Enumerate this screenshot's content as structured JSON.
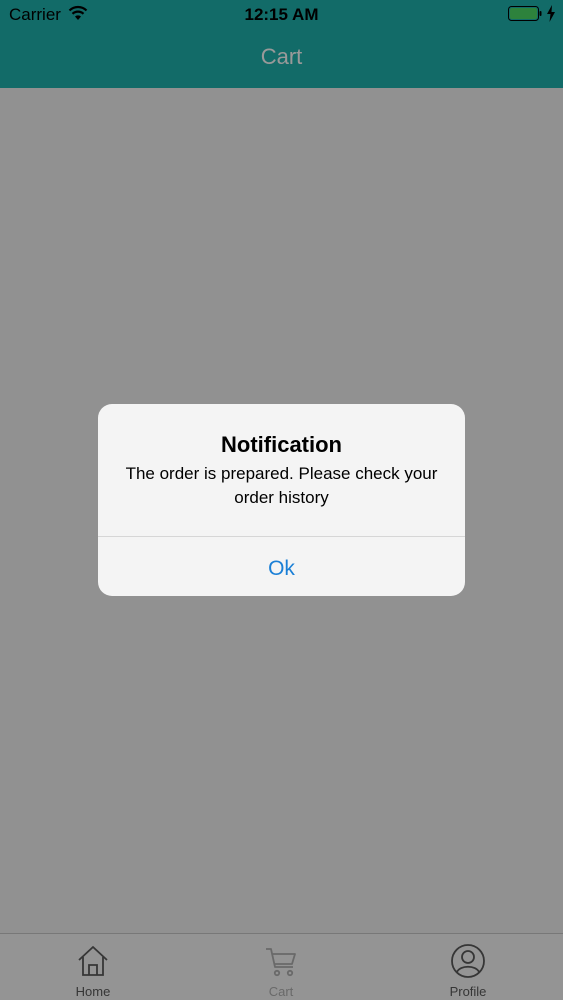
{
  "status_bar": {
    "carrier": "Carrier",
    "time": "12:15 AM",
    "battery_color": "#4cd964"
  },
  "nav": {
    "title": "Cart",
    "background": "#1fb3ad"
  },
  "tabs": [
    {
      "label": "Home",
      "icon": "home-icon"
    },
    {
      "label": "Cart",
      "icon": "cart-icon"
    },
    {
      "label": "Profile",
      "icon": "profile-icon"
    }
  ],
  "alert": {
    "title": "Notification",
    "message": "The order is prepared. Please check your order history",
    "button_label": "Ok",
    "button_color": "#1a7fd6"
  }
}
